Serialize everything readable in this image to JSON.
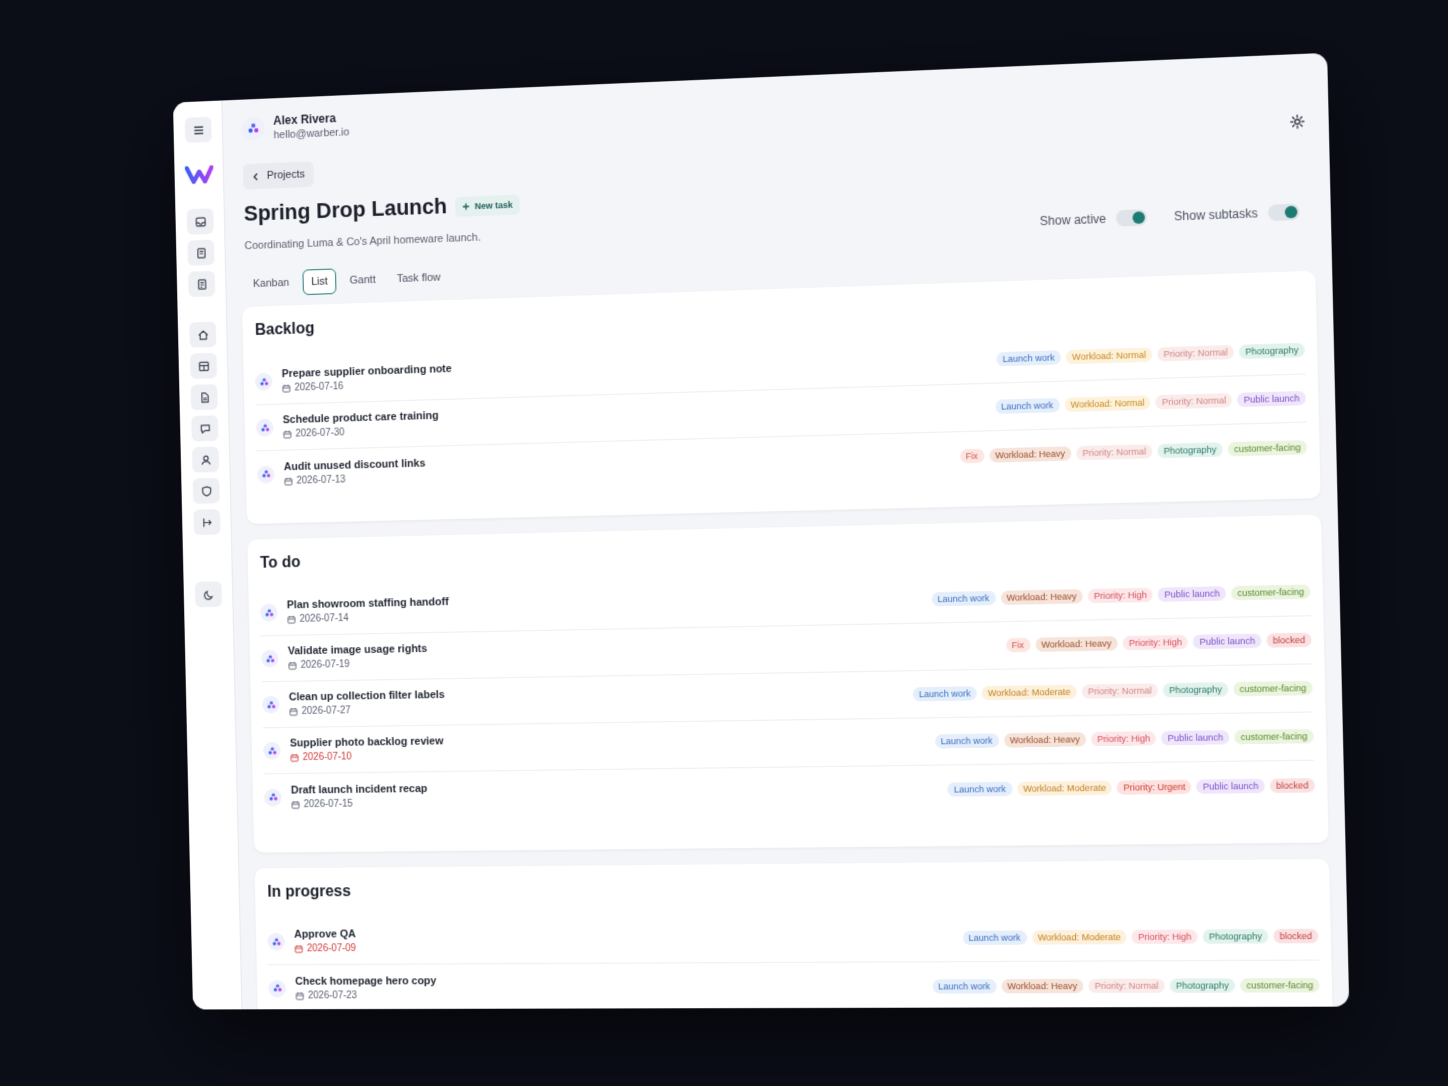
{
  "user": {
    "name": "Alex Rivera",
    "email": "hello@warber.io"
  },
  "nav": {
    "back_label": "Projects"
  },
  "project": {
    "title": "Spring Drop Launch",
    "new_task_label": "New task",
    "subtitle": "Coordinating Luma & Co's April homeware launch."
  },
  "toggles": {
    "show_active": "Show active",
    "show_subtasks": "Show subtasks"
  },
  "tabs": [
    "Kanban",
    "List",
    "Gantt",
    "Task flow"
  ],
  "active_tab": "List",
  "sections": [
    {
      "title": "Backlog",
      "tasks": [
        {
          "name": "Prepare supplier onboarding note",
          "date": "2026-07-16",
          "overdue": false,
          "tags": [
            "Launch work",
            "Workload: Normal",
            "Priority: Normal",
            "Photography"
          ]
        },
        {
          "name": "Schedule product care training",
          "date": "2026-07-30",
          "overdue": false,
          "tags": [
            "Launch work",
            "Workload: Normal",
            "Priority: Normal",
            "Public launch"
          ]
        },
        {
          "name": "Audit unused discount links",
          "date": "2026-07-13",
          "overdue": false,
          "tags": [
            "Fix",
            "Workload: Heavy",
            "Priority: Normal",
            "Photography",
            "customer-facing"
          ]
        }
      ]
    },
    {
      "title": "To do",
      "tasks": [
        {
          "name": "Plan showroom staffing handoff",
          "date": "2026-07-14",
          "overdue": false,
          "tags": [
            "Launch work",
            "Workload: Heavy",
            "Priority: High",
            "Public launch",
            "customer-facing"
          ]
        },
        {
          "name": "Validate image usage rights",
          "date": "2026-07-19",
          "overdue": false,
          "tags": [
            "Fix",
            "Workload: Heavy",
            "Priority: High",
            "Public launch",
            "blocked"
          ]
        },
        {
          "name": "Clean up collection filter labels",
          "date": "2026-07-27",
          "overdue": false,
          "tags": [
            "Launch work",
            "Workload: Moderate",
            "Priority: Normal",
            "Photography",
            "customer-facing"
          ]
        },
        {
          "name": "Supplier photo backlog review",
          "date": "2026-07-10",
          "overdue": true,
          "tags": [
            "Launch work",
            "Workload: Heavy",
            "Priority: High",
            "Public launch",
            "customer-facing"
          ]
        },
        {
          "name": "Draft launch incident recap",
          "date": "2026-07-15",
          "overdue": false,
          "tags": [
            "Launch work",
            "Workload: Moderate",
            "Priority: Urgent",
            "Public launch",
            "blocked"
          ]
        }
      ]
    },
    {
      "title": "In progress",
      "tasks": [
        {
          "name": "Approve QA",
          "date": "2026-07-09",
          "overdue": true,
          "tags": [
            "Launch work",
            "Workload: Moderate",
            "Priority: High",
            "Photography",
            "blocked"
          ]
        },
        {
          "name": "Check homepage hero copy",
          "date": "2026-07-23",
          "overdue": false,
          "tags": [
            "Launch work",
            "Workload: Heavy",
            "Priority: Normal",
            "Photography",
            "customer-facing"
          ]
        }
      ]
    }
  ],
  "colors": {
    "accent": "#1d7c72",
    "overdue": "#d23b3b",
    "logo_start": "#3f5ef5",
    "logo_end": "#b03ff0"
  },
  "icons": [
    "menu-icon",
    "inbox-icon",
    "notes-icon",
    "document-icon",
    "home-icon",
    "layout-icon",
    "file-icon",
    "chat-icon",
    "user-icon",
    "shield-icon",
    "logout-icon",
    "moon-icon",
    "gear-icon",
    "chevron-left-icon",
    "plus-icon",
    "calendar-icon"
  ]
}
